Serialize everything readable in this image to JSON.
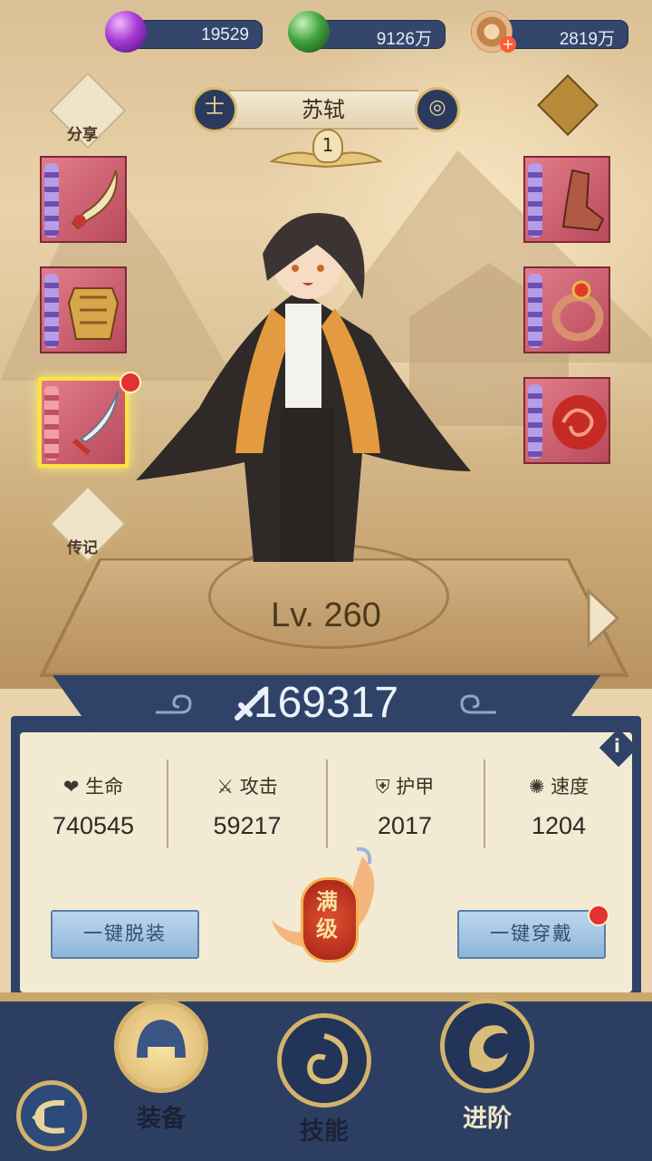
{
  "currency": [
    {
      "icon": "purple-gem-icon",
      "value": "19529",
      "color": "#9b35c9"
    },
    {
      "icon": "green-orb-icon",
      "value": "9126万",
      "color": "#3e8e3e"
    },
    {
      "icon": "copper-coin-icon",
      "value": "2819万",
      "color": "#c78f5b"
    }
  ],
  "hero": {
    "name": "苏轼",
    "star": "1",
    "level": "Lv. 260",
    "power": "169317"
  },
  "side_left": {
    "share_label": "分享",
    "biography_label": "传记"
  },
  "stats": [
    {
      "icon": "heart-icon",
      "label": "生命",
      "value": "740545"
    },
    {
      "icon": "crossed-swords-icon",
      "label": "攻击",
      "value": "59217"
    },
    {
      "icon": "shield-icon",
      "label": "护甲",
      "value": "2017"
    },
    {
      "icon": "speed-swirl-icon",
      "label": "速度",
      "value": "1204"
    }
  ],
  "actions": {
    "unequip_all": "一键脱装",
    "equip_all": "一键穿戴",
    "max_level_badge": "满级"
  },
  "nav": [
    {
      "icon": "helmet-icon",
      "label": "装备",
      "active": true
    },
    {
      "icon": "spiral-skill-icon",
      "label": "技能",
      "active": false
    },
    {
      "icon": "phoenix-advance-icon",
      "label": "进阶",
      "active": false
    }
  ],
  "colors": {
    "navy": "#2f4369",
    "gold": "#d3b26a",
    "slot_red": "#c9586a",
    "highlight": "#ffe43f"
  }
}
